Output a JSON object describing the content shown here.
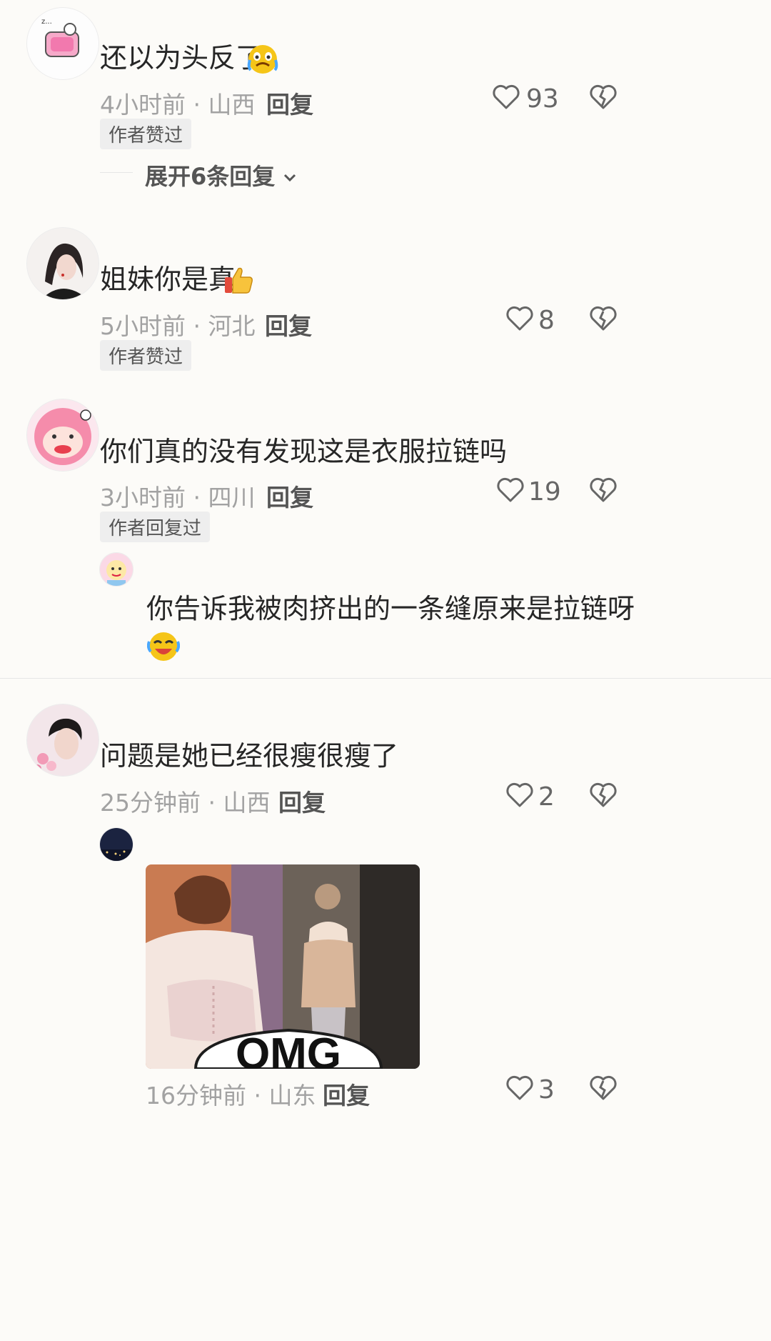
{
  "comments": [
    {
      "text": "还以为头反了",
      "time": "4小时前",
      "location": "山西",
      "reply_label": "回复",
      "likes": "93",
      "badge": "作者赞过",
      "expand_label": "展开6条回复",
      "emoji": "crying-face"
    },
    {
      "text": "姐妹你是真",
      "time": "5小时前",
      "location": "河北",
      "reply_label": "回复",
      "likes": "8",
      "badge": "作者赞过",
      "emoji": "thumbs-up"
    },
    {
      "text": "你们真的没有发现这是衣服拉链吗",
      "time": "3小时前",
      "location": "四川",
      "reply_label": "回复",
      "likes": "19",
      "badge": "作者回复过",
      "reply": {
        "text": "你告诉我被肉挤出的一条缝原来是拉链呀",
        "emoji": "laughing-crying-face"
      }
    },
    {
      "text": "问题是她已经很瘦很瘦了",
      "time": "25分钟前",
      "location": "山西",
      "reply_label": "回复",
      "likes": "2",
      "reply": {
        "time": "16分钟前",
        "location": "山东",
        "reply_label": "回复",
        "likes": "3",
        "image_caption": "OMG"
      }
    }
  ],
  "separator": "·",
  "colors": {
    "background": "#fcfbf8",
    "meta": "#a2a2a2",
    "text": "#262626"
  }
}
